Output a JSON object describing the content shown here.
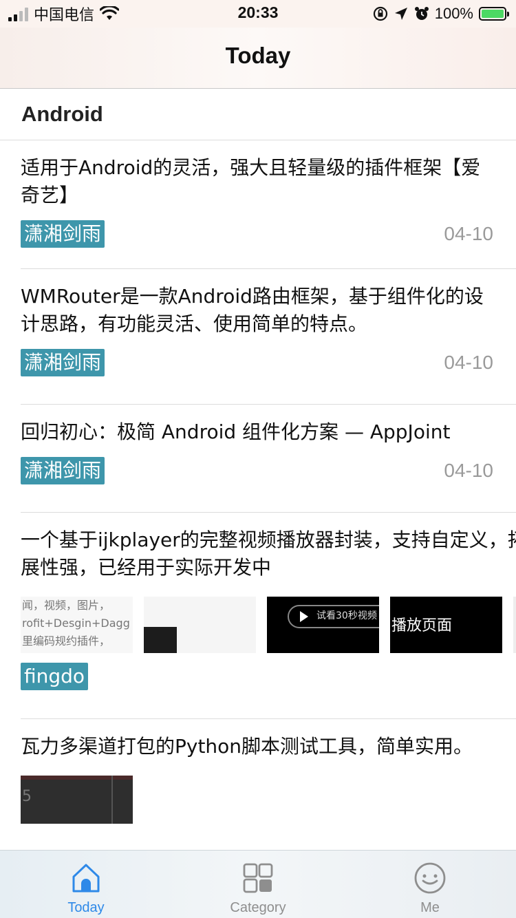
{
  "status_bar": {
    "carrier": "中国电信",
    "time": "20:33",
    "battery": "100%"
  },
  "nav": {
    "title": "Today"
  },
  "section": {
    "title": "Android"
  },
  "articles": [
    {
      "title": "适用于Android的灵活，强大且轻量级的插件框架【爱奇艺】",
      "author": "潇湘剑雨",
      "date": "04-10"
    },
    {
      "title": "WMRouter是一款Android路由框架，基于组件化的设计思路，有功能灵活、使用简单的特点。",
      "author": "潇湘剑雨",
      "date": "04-10"
    },
    {
      "title": "回归初心：极简 Android 组件化方案 — AppJoint",
      "author": "潇湘剑雨",
      "date": "04-10"
    },
    {
      "title": "一个基于ijkplayer的完整视频播放器封装，支持自定义，拓展性强，已经用于实际开发中",
      "author": "fingdo",
      "date": "",
      "thumb_text": [
        "闻，视频，图片，",
        "rofit+Desgin+Dagg",
        "里编码规约插件，"
      ],
      "thumb3_text": "试看30秒视频",
      "thumb4_text": "播放页面"
    },
    {
      "title": "瓦力多渠道打包的Python脚本测试工具，简单实用。",
      "thumb_num": "5"
    }
  ],
  "tabs": [
    {
      "label": "Today",
      "icon": "home-icon",
      "active": true
    },
    {
      "label": "Category",
      "icon": "grid-icon",
      "active": false
    },
    {
      "label": "Me",
      "icon": "smiley-icon",
      "active": false
    }
  ],
  "colors": {
    "tag_bg": "#3e96ab",
    "tab_active": "#2e89e8",
    "tab_inactive": "#8e8e8e"
  }
}
